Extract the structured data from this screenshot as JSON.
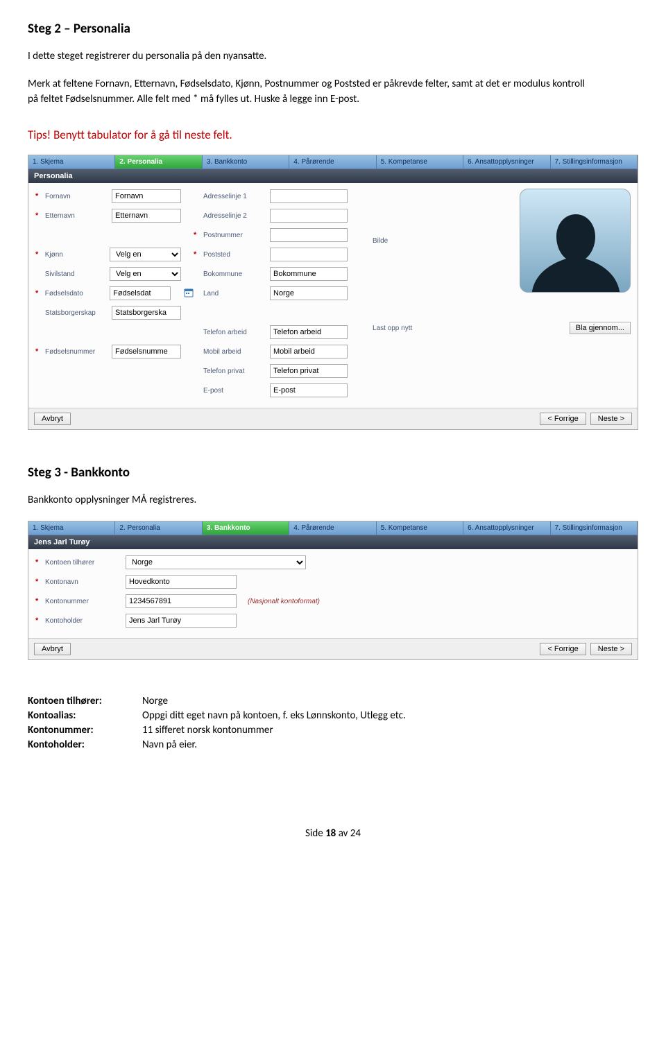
{
  "step2": {
    "title": "Steg 2 – Personalia",
    "intro": "I dette steget registrerer du personalia på den nyansatte.",
    "desc": "Merk at feltene Fornavn, Etternavn, Fødselsdato, Kjønn, Postnummer og Poststed er påkrevde felter, samt at det er modulus kontroll på feltet Fødselsnummer. Alle felt med * må fylles ut. Huske å legge inn E-post.",
    "tip": "Tips! Benytt tabulator for å gå til neste felt."
  },
  "tabs": [
    "1. Skjema",
    "2. Personalia",
    "3. Bankkonto",
    "4. Pårørende",
    "5. Kompetanse",
    "6. Ansattopplysninger",
    "7. Stillingsinformasjon"
  ],
  "personalia": {
    "section_title": "Personalia",
    "left": {
      "fornavn": {
        "label": "Fornavn",
        "value": "Fornavn",
        "req": "*"
      },
      "etternavn": {
        "label": "Etternavn",
        "value": "Etternavn",
        "req": "*"
      },
      "kjonn": {
        "label": "Kjønn",
        "value": "Velg en",
        "req": "*"
      },
      "sivilstand": {
        "label": "Sivilstand",
        "value": "Velg en",
        "req": ""
      },
      "fodselsdato": {
        "label": "Fødselsdato",
        "value": "Fødselsdat",
        "req": "*"
      },
      "statsborgerskap": {
        "label": "Statsborgerskap",
        "value": "Statsborgerska",
        "req": ""
      },
      "fodselsnummer": {
        "label": "Fødselsnummer",
        "value": "Fødselsnumme",
        "req": "*"
      }
    },
    "mid": {
      "adr1": {
        "label": "Adresselinje 1",
        "value": "",
        "req": ""
      },
      "adr2": {
        "label": "Adresselinje 2",
        "value": "",
        "req": ""
      },
      "postnr": {
        "label": "Postnummer",
        "value": "",
        "req": "*"
      },
      "poststed": {
        "label": "Poststed",
        "value": "",
        "req": "*"
      },
      "bokommune": {
        "label": "Bokommune",
        "value": "Bokommune",
        "req": ""
      },
      "land": {
        "label": "Land",
        "value": "Norge",
        "req": ""
      },
      "tlf_arbeid": {
        "label": "Telefon arbeid",
        "value": "Telefon arbeid",
        "req": ""
      },
      "mobil_arbeid": {
        "label": "Mobil arbeid",
        "value": "Mobil arbeid",
        "req": ""
      },
      "tlf_privat": {
        "label": "Telefon privat",
        "value": "Telefon privat",
        "req": ""
      },
      "epost": {
        "label": "E-post",
        "value": "E-post",
        "req": ""
      }
    },
    "right": {
      "bilde_label": "Bilde",
      "last_opp": "Last opp nytt",
      "browse": "Bla gjennom..."
    }
  },
  "buttons": {
    "avbryt": "Avbryt",
    "forrige": "< Forrige",
    "neste": "Neste >"
  },
  "step3": {
    "title": "Steg 3 - Bankkonto",
    "intro": "Bankkonto opplysninger MÅ registreres.",
    "section_title": "Jens Jarl Turøy",
    "fields": {
      "tilhorer": {
        "label": "Kontoen tilhører",
        "value": "Norge",
        "req": "*"
      },
      "kontonavn": {
        "label": "Kontonavn",
        "value": "Hovedkonto",
        "req": "*"
      },
      "kontonummer": {
        "label": "Kontonummer",
        "value": "1234567891",
        "req": "*",
        "note": "(Nasjonalt kontoformat)"
      },
      "kontoholder": {
        "label": "Kontoholder",
        "value": "Jens Jarl Turøy",
        "req": "*"
      }
    }
  },
  "defs": {
    "tilhorer": {
      "term": "Kontoen tilhører:",
      "desc": "Norge"
    },
    "alias": {
      "term": "Kontoalias:",
      "desc": "Oppgi ditt eget navn på kontoen, f. eks Lønnskonto, Utlegg etc."
    },
    "nummer": {
      "term": "Kontonummer:",
      "desc": "11 sifferet norsk kontonummer"
    },
    "holder": {
      "term": "Kontoholder:",
      "desc": "Navn på eier."
    }
  },
  "footer": {
    "prefix": "Side ",
    "bold": "18",
    "suffix": " av 24"
  }
}
